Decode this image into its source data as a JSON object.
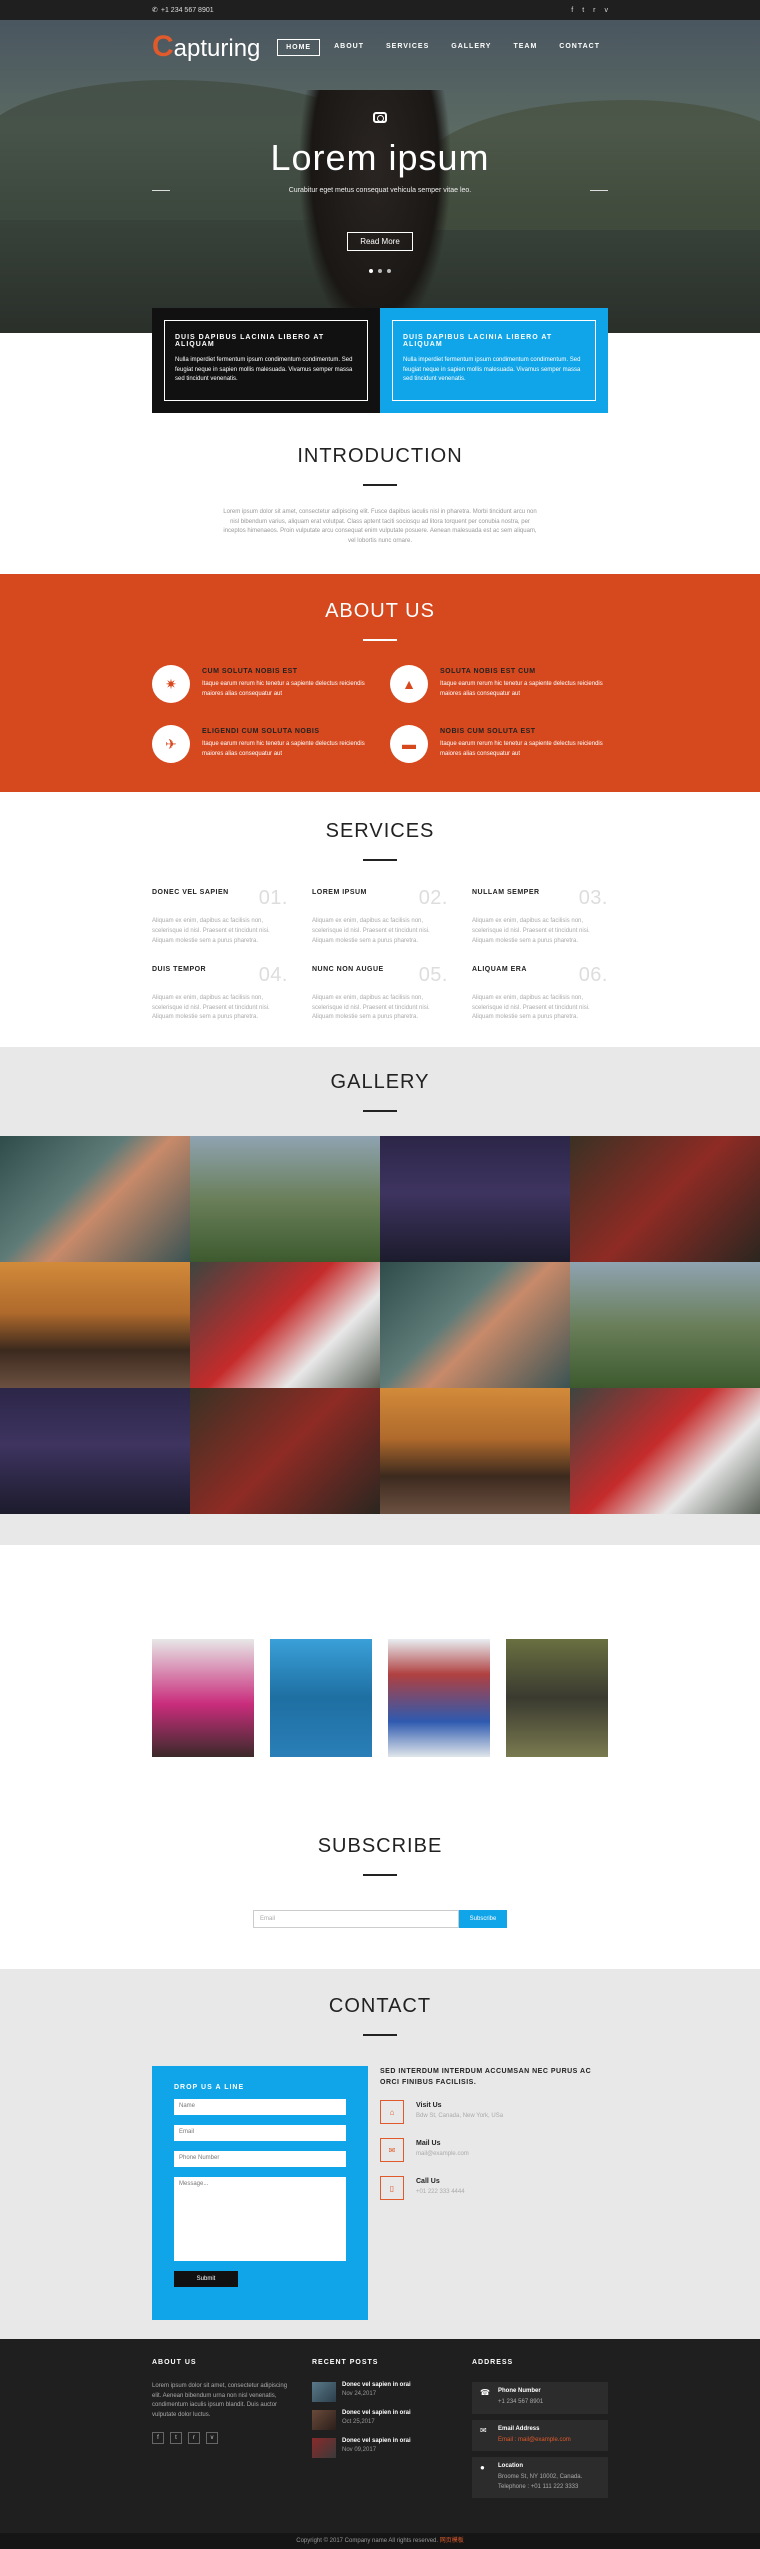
{
  "topbar": {
    "phone": "+1 234 567 8901",
    "social": [
      "f",
      "t",
      "r",
      "v"
    ]
  },
  "nav": {
    "logo_initial": "C",
    "logo_rest": "apturing",
    "items": [
      "HOME",
      "ABOUT",
      "SERVICES",
      "GALLERY",
      "TEAM",
      "CONTACT"
    ]
  },
  "hero": {
    "title": "Lorem ipsum",
    "subtitle": "Curabitur eget metus consequat vehicula semper vitae leo.",
    "button": "Read More"
  },
  "features": [
    {
      "title": "DUIS DAPIBUS LACINIA LIBERO AT ALIQUAM",
      "text": "Nulla imperdiet fermentum ipsum condimentum condimentum. Sed feugiat neque in sapien mollis malesuada. Vivamus semper massa sed tincidunt venenatis."
    },
    {
      "title": "DUIS DAPIBUS LACINIA LIBERO AT ALIQUAM",
      "text": "Nulla imperdiet fermentum ipsum condimentum condimentum. Sed feugiat neque in sapien mollis malesuada. Vivamus semper massa sed tincidunt venenatis."
    }
  ],
  "intro": {
    "title": "INTRODUCTION",
    "text": "Lorem ipsum dolor sit amet, consectetur adipiscing elit. Fusce dapibus iaculis nisl in pharetra. Morbi tincidunt arcu non nisl bibendum varius, aliquam erat volutpat. Class aptent taciti sociosqu ad litora torquent per conubia nostra, per inceptos himenaeos. Proin vulputate arcu consequat enim vulputate posuere. Aenean malesuada est ac sem aliquam, vel lobortis nunc ornare."
  },
  "about": {
    "title": "ABOUT US",
    "items": [
      {
        "title": "CUM SOLUTA NOBIS EST",
        "text": "Itaque earum rerum hic tenetur a sapiente delectus reiciendis maiores alias consequatur aut",
        "icon": "star-icon",
        "glyph": "✷"
      },
      {
        "title": "SOLUTA NOBIS EST CUM",
        "text": "Itaque earum rerum hic tenetur a sapiente delectus reiciendis maiores alias consequatur aut",
        "icon": "road-icon",
        "glyph": "▲"
      },
      {
        "title": "ELIGENDI CUM SOLUTA NOBIS",
        "text": "Itaque earum rerum hic tenetur a sapiente delectus reiciendis maiores alias consequatur aut",
        "icon": "plane-icon",
        "glyph": "✈"
      },
      {
        "title": "NOBIS CUM SOLUTA EST",
        "text": "Itaque earum rerum hic tenetur a sapiente delectus reiciendis maiores alias consequatur aut",
        "icon": "bus-icon",
        "glyph": "▬"
      }
    ]
  },
  "services": {
    "title": "SERVICES",
    "items": [
      {
        "title": "DONEC VEL SAPIEN",
        "num": "01.",
        "text": "Aliquam ex enim, dapibus ac facilisis non, scelerisque id nisl. Praesent et tincidunt nisi. Aliquam molestie sem a purus pharetra."
      },
      {
        "title": "LOREM IPSUM",
        "num": "02.",
        "text": "Aliquam ex enim, dapibus ac facilisis non, scelerisque id nisl. Praesent et tincidunt nisi. Aliquam molestie sem a purus pharetra."
      },
      {
        "title": "NULLAM SEMPER",
        "num": "03.",
        "text": "Aliquam ex enim, dapibus ac facilisis non, scelerisque id nisl. Praesent et tincidunt nisi. Aliquam molestie sem a purus pharetra."
      },
      {
        "title": "DUIS TEMPOR",
        "num": "04.",
        "text": "Aliquam ex enim, dapibus ac facilisis non, scelerisque id nisl. Praesent et tincidunt nisi. Aliquam molestie sem a purus pharetra."
      },
      {
        "title": "NUNC NON AUGUE",
        "num": "05.",
        "text": "Aliquam ex enim, dapibus ac facilisis non, scelerisque id nisl. Praesent et tincidunt nisi. Aliquam molestie sem a purus pharetra."
      },
      {
        "title": "ALIQUAM ERA",
        "num": "06.",
        "text": "Aliquam ex enim, dapibus ac facilisis non, scelerisque id nisl. Praesent et tincidunt nisi. Aliquam molestie sem a purus pharetra."
      }
    ]
  },
  "gallery": {
    "title": "GALLERY",
    "photos": [
      {
        "name": "gallery-woman-wall",
        "bg": "linear-gradient(135deg,#2f4c4a 0%,#5e7b78 40%,#c88a6a 55%,#3a5353 100%)"
      },
      {
        "name": "gallery-kids-camera",
        "bg": "linear-gradient(180deg,#8fa3b2 0%,#6a7f5a 50%,#3d5a2e 100%)"
      },
      {
        "name": "gallery-tent-night",
        "bg": "linear-gradient(180deg,#2c2648 0%,#3e3460 45%,#1c1b2c 100%)"
      },
      {
        "name": "gallery-woman-red",
        "bg": "linear-gradient(135deg,#3a3124 0%,#8e2b24 50%,#2b2620 100%)"
      },
      {
        "name": "gallery-mountain-sunset",
        "bg": "linear-gradient(180deg,#d28a3a 0%,#b06a2c 40%,#3c2a1e 70%,#6b5040 100%)"
      },
      {
        "name": "gallery-red-jacket",
        "bg": "linear-gradient(135deg,#3d4540 0%,#c52b2b 45%,#e8e8e8 70%,#5a6258 100%)"
      },
      {
        "name": "gallery-woman-wall-2",
        "bg": "linear-gradient(135deg,#2f4c4a 0%,#5e7b78 40%,#c88a6a 55%,#3a5353 100%)"
      },
      {
        "name": "gallery-kids-camera-2",
        "bg": "linear-gradient(180deg,#8fa3b2 0%,#6a7f5a 50%,#3d5a2e 100%)"
      },
      {
        "name": "gallery-tent-night-2",
        "bg": "linear-gradient(180deg,#2c2648 0%,#3e3460 45%,#1c1b2c 100%)"
      },
      {
        "name": "gallery-woman-red-2",
        "bg": "linear-gradient(135deg,#3a3124 0%,#8e2b24 50%,#2b2620 100%)"
      },
      {
        "name": "gallery-mountain-sunset-2",
        "bg": "linear-gradient(180deg,#d28a3a 0%,#b06a2c 40%,#3c2a1e 70%,#6b5040 100%)"
      },
      {
        "name": "gallery-red-jacket-2",
        "bg": "linear-gradient(135deg,#3d4540 0%,#c52b2b 45%,#e8e8e8 70%,#5a6258 100%)"
      }
    ]
  },
  "team": [
    {
      "name": "team-member-1",
      "bg": "linear-gradient(180deg,#e7e7e7 0%,#c92d7c 55%,#3b2a2a 100%)"
    },
    {
      "name": "team-member-2",
      "bg": "linear-gradient(180deg,#3aa0d8 0%,#1e6fa2 50%,#2a7fb8 100%)"
    },
    {
      "name": "team-member-3",
      "bg": "linear-gradient(180deg,#e8eef2 0%,#b04040 30%,#2e5ab0 70%,#dfe6ea 100%)"
    },
    {
      "name": "team-member-4",
      "bg": "linear-gradient(180deg,#6a7040 0%,#3a3a30 50%,#7a7a50 100%)"
    }
  ],
  "subscribe": {
    "title": "SUBSCRIBE",
    "placeholder": "Email",
    "button": "Subscribe"
  },
  "contact": {
    "title": "CONTACT",
    "form_title": "DROP US A LINE",
    "fields": [
      "Name",
      "Email",
      "Phone Number",
      "Message..."
    ],
    "submit": "Submit",
    "heading": "SED INTERDUM INTERDUM ACCUMSAN NEC PURUS AC ORCI FINIBUS FACILISIS.",
    "info": [
      {
        "title": "Visit Us",
        "text": "Bdw St, Canada, New York, USa",
        "icon": "home-icon",
        "glyph": "⌂"
      },
      {
        "title": "Mail Us",
        "text": "mail@example.com",
        "icon": "mail-icon",
        "glyph": "✉"
      },
      {
        "title": "Call Us",
        "text": "+01 222 333 4444",
        "icon": "phone-icon",
        "glyph": "▯"
      }
    ]
  },
  "footer": {
    "about_title": "ABOUT US",
    "about_text": "Lorem ipsum dolor sit amet, consectetur adipiscing elit. Aenean bibendum urna non nisl venenatis, condimentum iaculis ipsum blandit. Duis auctor vulputate dolor luctus.",
    "social": [
      "f",
      "t",
      "r",
      "v"
    ],
    "posts_title": "RECENT POSTS",
    "posts": [
      {
        "title": "Donec vel sapien in orai",
        "date": "Nov 24,2017",
        "bg": "linear-gradient(135deg,#5a7a8a,#2c3e4a)"
      },
      {
        "title": "Donec vel sapien in orai",
        "date": "Oct 25,2017",
        "bg": "linear-gradient(135deg,#6a4a3a,#2a1e1a)"
      },
      {
        "title": "Donec vel sapien in orai",
        "date": "Nov 09,2017",
        "bg": "linear-gradient(135deg,#8a2a2a,#3a3a3a)"
      }
    ],
    "address_title": "ADDRESS",
    "address": [
      {
        "title": "Phone Number",
        "lines": [
          "+1 234 567 8901"
        ],
        "icon": "phone-icon",
        "glyph": "☎"
      },
      {
        "title": "Email Address",
        "lines": [
          "Email : mail@example.com"
        ],
        "icon": "envelope-icon",
        "glyph": "✉"
      },
      {
        "title": "Location",
        "lines": [
          "Broome St, NY 10002, Canada.",
          "Telephone : +01 111 222 3333"
        ],
        "icon": "location-icon",
        "glyph": "●"
      }
    ],
    "copyright_text": "Copyright © 2017 Company name All rights reserved.",
    "copyright_link": "网页模板"
  }
}
